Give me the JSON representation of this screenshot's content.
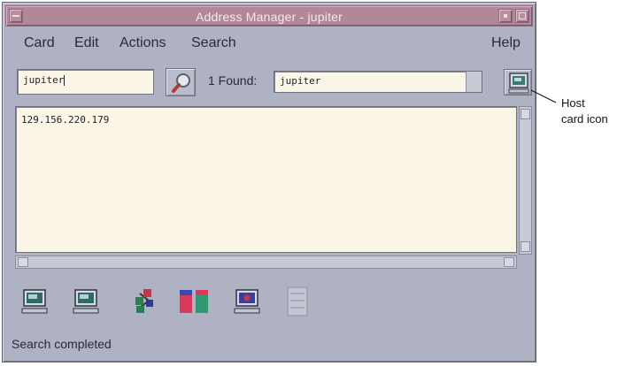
{
  "window": {
    "title": "Address Manager - jupiter"
  },
  "menubar": {
    "items": [
      "Card",
      "Edit",
      "Actions",
      "Search"
    ],
    "help": "Help"
  },
  "search": {
    "input_value": "jupiter",
    "found_label": "1 Found:",
    "found_value": "jupiter"
  },
  "content": {
    "text": "129.156.220.179"
  },
  "toolbar": {
    "buttons": [
      "host-card",
      "host-card",
      "network-card",
      "system-info-card",
      "user-card",
      "blank-card"
    ]
  },
  "status": {
    "text": "Search completed"
  },
  "annotation": {
    "line1": "Host",
    "line2": "card icon"
  },
  "colors": {
    "titlebar": "#b2879a",
    "window_bg": "#aeb2c3",
    "field_bg": "#fbf5e6"
  }
}
